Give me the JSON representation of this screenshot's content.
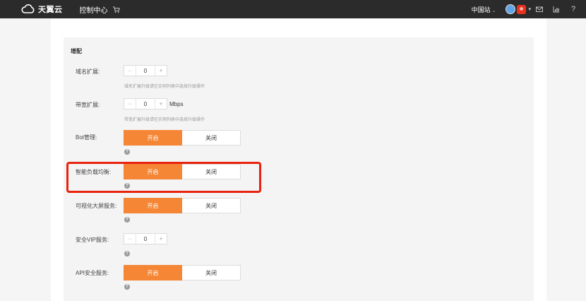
{
  "header": {
    "brand": "天翼云",
    "console": "控制中心",
    "region": "中国站",
    "icons": [
      "cloud-logo-icon",
      "cart-icon",
      "mail-icon",
      "chart-icon",
      "help-icon"
    ]
  },
  "section": {
    "title": "增配"
  },
  "domain_ext": {
    "label": "域名扩展:",
    "value": "0",
    "minus": "−",
    "plus": "+",
    "hint": "域名扩展升级请在实例列表中选择升级操作"
  },
  "bandwidth_ext": {
    "label": "带宽扩展:",
    "value": "0",
    "minus": "−",
    "plus": "+",
    "unit": "Mbps",
    "hint": "带宽扩展升级请在实例列表中选择升级操作"
  },
  "bot": {
    "label": "Bot管理:",
    "on": "开启",
    "off": "关闭"
  },
  "smart_lb": {
    "label": "智能负载均衡:",
    "on": "开启",
    "off": "关闭"
  },
  "visual_screen": {
    "label": "可视化大屏服务:",
    "on": "开启",
    "off": "关闭"
  },
  "vip": {
    "label": "安全VIP服务:",
    "value": "0",
    "minus": "−",
    "plus": "+"
  },
  "api_sec": {
    "label": "API安全服务:",
    "on": "开启",
    "off": "关闭"
  },
  "help_glyph": "?",
  "colors": {
    "accent": "#f58635",
    "highlight": "#e8230f",
    "topbar": "#2b2b2b"
  }
}
